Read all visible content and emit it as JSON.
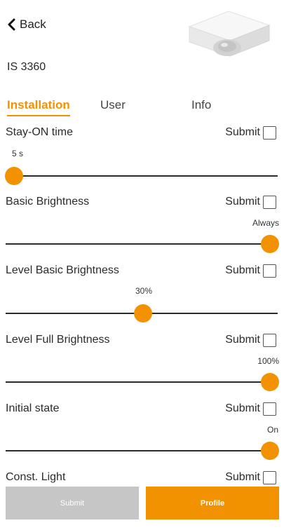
{
  "header": {
    "back_label": "Back",
    "device_name": "IS 3360"
  },
  "tabs": [
    {
      "label": "Installation",
      "active": true
    },
    {
      "label": "User",
      "active": false
    },
    {
      "label": "Info",
      "active": false
    }
  ],
  "settings": [
    {
      "title": "Stay-ON time",
      "submit_label": "Submit",
      "checked": false,
      "value_label": "5 s",
      "level": 0.0
    },
    {
      "title": "Basic Brightness",
      "submit_label": "Submit",
      "checked": false,
      "value_label": "Always",
      "level": 1.0
    },
    {
      "title": "Level Basic Brightness",
      "submit_label": "Submit",
      "checked": false,
      "value_label": "30%",
      "level": 0.5
    },
    {
      "title": "Level Full Brightness",
      "submit_label": "Submit",
      "checked": false,
      "value_label": "100%",
      "level": 1.0
    },
    {
      "title": "Initial state",
      "submit_label": "Submit",
      "checked": false,
      "value_label": "On",
      "level": 1.0
    },
    {
      "title": "Const. Light",
      "submit_label": "Submit",
      "checked": false
    }
  ],
  "footer": {
    "submit_label": "Submit",
    "profile_label": "Profile"
  },
  "colors": {
    "accent": "#f39200",
    "disabled_button": "#c6c6c6"
  },
  "icons": {
    "back": "chevron-left-icon",
    "device": "presence-detector-image"
  }
}
